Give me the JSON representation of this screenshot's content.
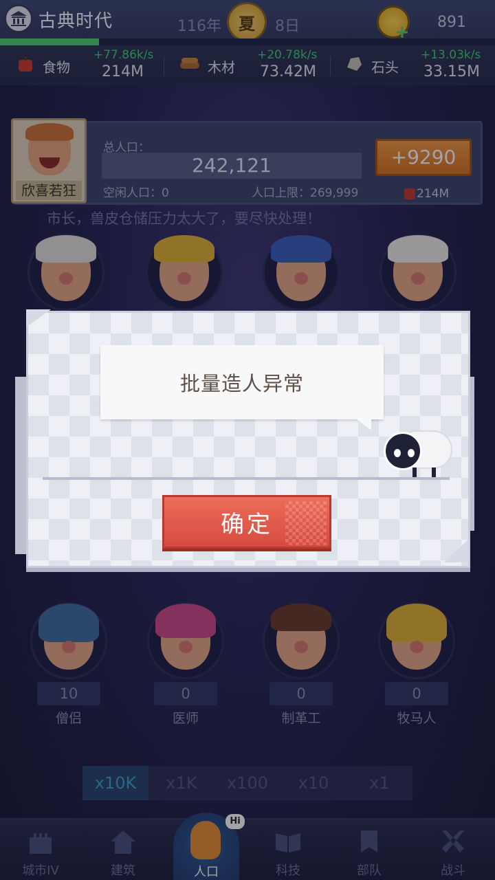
{
  "header": {
    "era_name": "古典时代",
    "year": "116年",
    "season": "夏",
    "day": "8日",
    "gold": "891",
    "era_progress": 0.2
  },
  "resources": [
    {
      "label": "食物",
      "rate": "+77.86k/s",
      "total": "214M",
      "icon": "apple-icon"
    },
    {
      "label": "木材",
      "rate": "+20.78k/s",
      "total": "73.42M",
      "icon": "wood-icon"
    },
    {
      "label": "石头",
      "rate": "+13.03k/s",
      "total": "33.15M",
      "icon": "stone-icon"
    }
  ],
  "population": {
    "mayor_mood": "欣喜若狂",
    "total_label": "总人口：",
    "total_value": "242,121",
    "idle_label": "空闲人口：0",
    "cap_label": "人口上限：269,999",
    "add_button": "+9290",
    "add_cost": "214M",
    "mayor_message": "市长，兽皮仓储压力太大了，要尽快处理！"
  },
  "roles": [
    {
      "name": "僧侣",
      "count": "10"
    },
    {
      "name": "医师",
      "count": "0"
    },
    {
      "name": "制革工",
      "count": "0"
    },
    {
      "name": "牧马人",
      "count": "0"
    }
  ],
  "multipliers": [
    {
      "label": "x10K",
      "active": true
    },
    {
      "label": "x1K",
      "active": false
    },
    {
      "label": "x100",
      "active": false
    },
    {
      "label": "x10",
      "active": false
    },
    {
      "label": "x1",
      "active": false
    }
  ],
  "nav": [
    {
      "label": "城市IV",
      "icon": "castle-icon"
    },
    {
      "label": "建筑",
      "icon": "house-icon"
    },
    {
      "label": "人口",
      "icon": "person-icon",
      "badge": "Hi"
    },
    {
      "label": "科技",
      "icon": "book-icon"
    },
    {
      "label": "部队",
      "icon": "banner-icon"
    },
    {
      "label": "战斗",
      "icon": "crossed-swords-icon"
    }
  ],
  "dialog": {
    "message": "批量造人异常",
    "confirm_label": "确定"
  }
}
